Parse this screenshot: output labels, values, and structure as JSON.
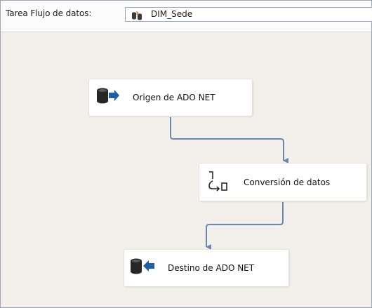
{
  "toolbar": {
    "task_label": "Tarea Flujo de datos:",
    "task_value": "DIM_Sede",
    "task_icon": "data-flow-task-icon"
  },
  "nodes": [
    {
      "label": "Origen de ADO NET",
      "icon": "ado-net-source-icon"
    },
    {
      "label": "Conversión de datos",
      "icon": "data-conversion-icon"
    },
    {
      "label": "Destino de ADO NET",
      "icon": "ado-net-destination-icon"
    }
  ],
  "colors": {
    "canvas": "#f3f0eb",
    "connector": "#6a87ad",
    "icon_dark": "#262626",
    "icon_arrow": "#1f5fa8"
  }
}
